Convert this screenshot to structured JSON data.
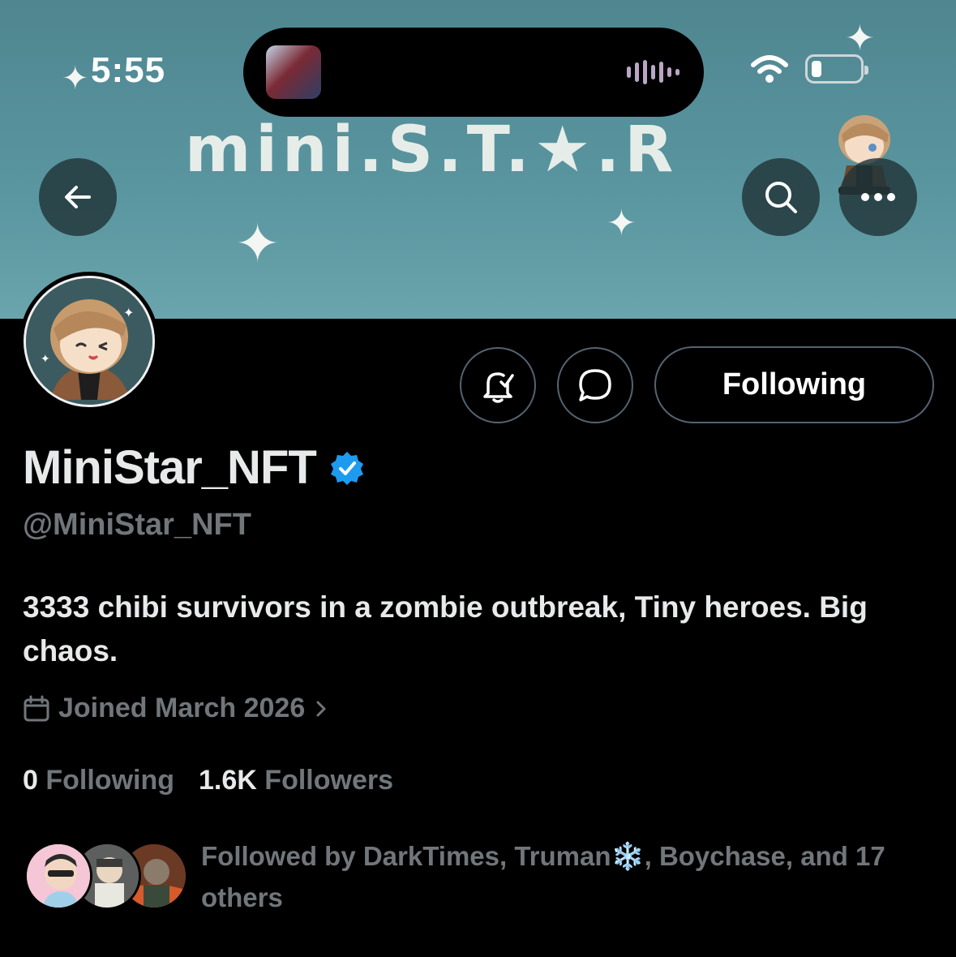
{
  "status_bar": {
    "time": "5:55"
  },
  "banner": {
    "text": "mini.S.T.★.R"
  },
  "profile": {
    "display_name": "MiniStar_NFT",
    "handle": "@MiniStar_NFT",
    "verified": true,
    "bio": "3333 chibi survivors in a zombie outbreak, Tiny heroes. Big chaos.",
    "joined": "Joined March 2026",
    "following_count": "0",
    "following_label": "Following",
    "followers_count": "1.6K",
    "followers_label": "Followers",
    "followed_by": "Followed by DarkTimes, Truman❄️, Boychase, and 17 others"
  },
  "actions": {
    "follow_state": "Following"
  },
  "icons": {
    "back": "arrow-left-icon",
    "search": "search-icon",
    "more": "more-icon",
    "notify": "bell-check-icon",
    "message": "chat-bubble-icon",
    "calendar": "calendar-icon",
    "verified": "verified-badge-icon"
  },
  "colors": {
    "banner": "#5a96a0",
    "background": "#000000",
    "verified_blue": "#1d9bf0",
    "secondary_text": "#71767b",
    "border": "#536471"
  }
}
